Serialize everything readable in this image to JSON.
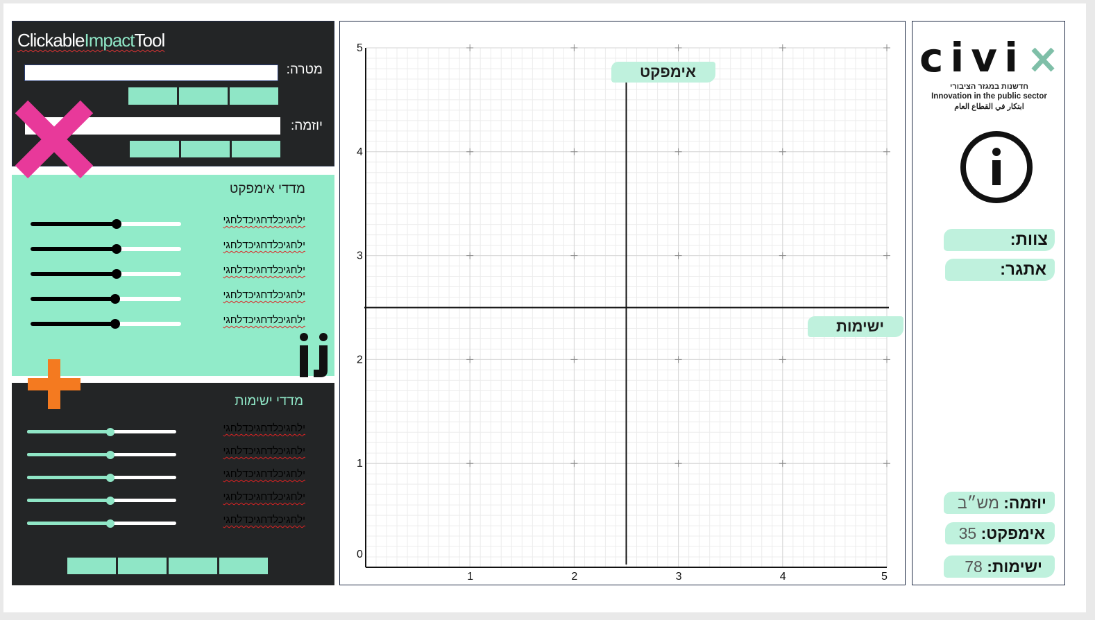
{
  "app": {
    "title_part1": "Clickable",
    "title_part2": "Impact",
    "title_part3": "Tool"
  },
  "goal": {
    "label": "מטרה:",
    "value": ""
  },
  "initiative": {
    "label": "יוזמה:",
    "value": ""
  },
  "impact_metrics": {
    "title": "מדדי אימפקט",
    "items": [
      {
        "label": "ילחגיכלדחגיכדלחגי",
        "value": 0.57
      },
      {
        "label": "ילחגיכלדחגיכדלחגי",
        "value": 0.57
      },
      {
        "label": "ילחגיכלדחגיכדלחגי",
        "value": 0.57
      },
      {
        "label": "ילחגיכלדחגיכדלחגי",
        "value": 0.56
      },
      {
        "label": "ילחגיכלדחגיכדלחגי",
        "value": 0.56
      }
    ]
  },
  "feasibility_metrics": {
    "title": "מדדי ישימות",
    "items": [
      {
        "label": "ילחגיכלדחגיכדלחגי",
        "value": 0.56
      },
      {
        "label": "ילחגיכלדחגיכדלחגי",
        "value": 0.56
      },
      {
        "label": "ילחגיכלדחגיכדלחגי",
        "value": 0.56
      },
      {
        "label": "ילחגיכלדחגיכדלחגי",
        "value": 0.56
      },
      {
        "label": "ילחגיכלדחגיכדלחגי",
        "value": 0.56
      }
    ]
  },
  "chart": {
    "x_ticks": [
      "1",
      "2",
      "3",
      "4",
      "5"
    ],
    "y_ticks": [
      "0",
      "1",
      "2",
      "3",
      "4",
      "5"
    ],
    "impact_label": "אימפקט",
    "feasibility_label": "ישימות",
    "x_range": [
      0,
      5
    ],
    "y_range": [
      0,
      5
    ],
    "vertical_divider_x": 2.5,
    "horizontal_divider_y": 2.5
  },
  "sidebar": {
    "logo_text": "civix",
    "tagline_he": "חדשנות במגזר הציבורי",
    "tagline_en": "Innovation in the public sector",
    "tagline_ar": "ابتكار في القطاع العام",
    "team_label": "צוות:",
    "challenge_label": "אתגר:",
    "initiative_label": "יוזמה:",
    "initiative_value": "מש״ב",
    "impact_label": "אימפקט:",
    "impact_value": "35",
    "feasibility_label": "ישימות:",
    "feasibility_value": "78"
  },
  "colors": {
    "accent_mint": "#8fe6c6",
    "panel_dark": "#232526",
    "x_mark_pink": "#e8399a",
    "plus_orange": "#f47a20"
  },
  "icons": [
    "close-x-icon",
    "add-plus-icon",
    "ij-icon",
    "info-icon",
    "civix-logo"
  ]
}
